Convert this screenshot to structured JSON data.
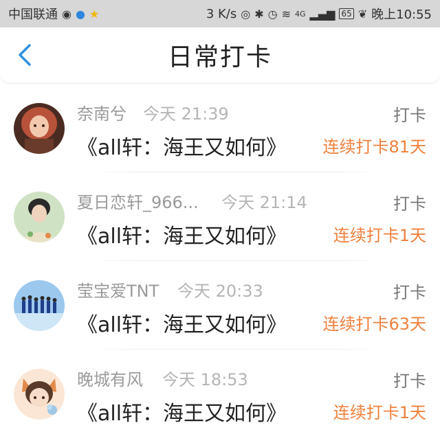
{
  "status_bar": {
    "carrier": "中国联通",
    "speed": "3 K/s",
    "network": "4G",
    "battery": "65",
    "time": "晚上10:55"
  },
  "header": {
    "title": "日常打卡"
  },
  "entries": [
    {
      "user": "奈南兮",
      "time": "今天 21:39",
      "work": "《all轩：海王又如何》",
      "checkin_label": "打卡",
      "streak": "连续打卡81天"
    },
    {
      "user": "夏日恋轩_966...",
      "time": "今天 21:14",
      "work": "《all轩：海王又如何》",
      "checkin_label": "打卡",
      "streak": "连续打卡1天"
    },
    {
      "user": "莹宝爱TNT",
      "time": "今天 20:33",
      "work": "《all轩：海王又如何》",
      "checkin_label": "打卡",
      "streak": "连续打卡63天"
    },
    {
      "user": "晚城有风",
      "time": "今天 18:53",
      "work": "《all轩：海王又如何》",
      "checkin_label": "打卡",
      "streak": "连续打卡1天"
    }
  ],
  "colors": {
    "accent": "#2e8fe0",
    "streak": "#f0803c",
    "username": "#9a9a9a",
    "status_bar_bg": "#d7d7d7"
  }
}
